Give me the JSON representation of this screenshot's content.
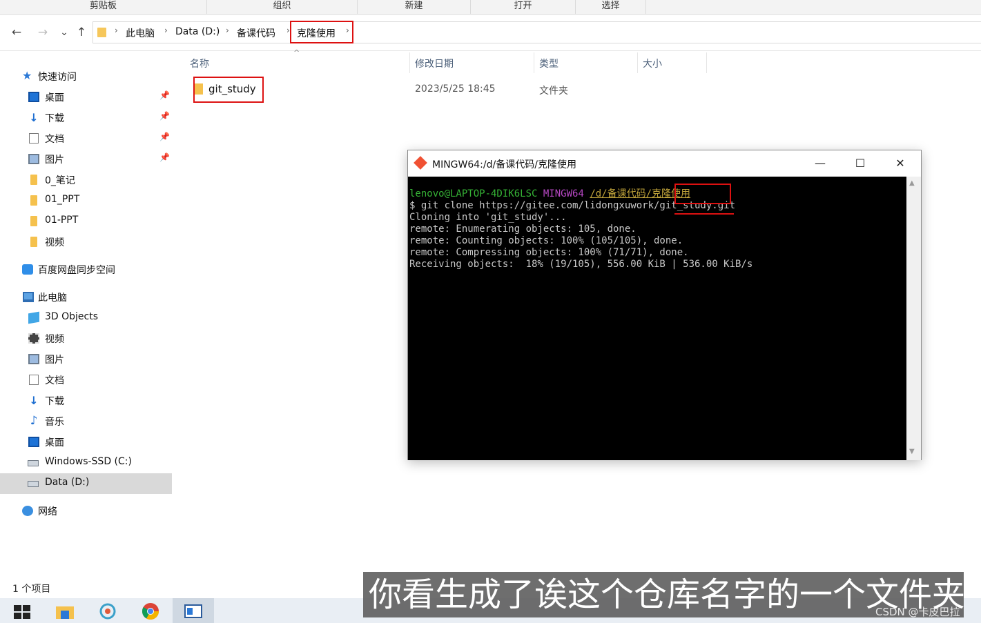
{
  "ribbon": {
    "groups": [
      "剪贴板",
      "组织",
      "新建",
      "打开",
      "选择"
    ]
  },
  "nav": {
    "back_icon": "←",
    "forward_icon": "→",
    "recent_icon": "⌄",
    "up_icon": "↑"
  },
  "address": {
    "crumbs": [
      "此电脑",
      "Data (D:)",
      "备课代码",
      "克隆使用"
    ],
    "separator": "›"
  },
  "sidebar": {
    "quick_access": "快速访问",
    "items_quick": [
      "桌面",
      "下载",
      "文档",
      "图片",
      "0_笔记",
      "01_PPT",
      "01-PPT",
      "视频"
    ],
    "baidu": "百度网盘同步空间",
    "this_pc": "此电脑",
    "items_pc": [
      "3D Objects",
      "视频",
      "图片",
      "文档",
      "下载",
      "音乐",
      "桌面",
      "Windows-SSD (C:)",
      "Data (D:)"
    ],
    "network": "网络"
  },
  "filelist": {
    "headers": [
      "名称",
      "修改日期",
      "类型",
      "大小"
    ],
    "rows": [
      {
        "name": "git_study",
        "date": "2023/5/25 18:45",
        "type": "文件夹",
        "size": ""
      }
    ]
  },
  "status": {
    "count": "1 个项目"
  },
  "terminal": {
    "title": "MINGW64:/d/备课代码/克隆使用",
    "prompt_user": "lenovo@LAPTOP-4DIK6LSC",
    "prompt_env": "MINGW64",
    "prompt_path_a": "/d/备课代码",
    "prompt_path_b": "/克隆使用",
    "lines": [
      "$ git clone https://gitee.com/lidongxuwork/git_study.git",
      "Cloning into 'git_study'...",
      "remote: Enumerating objects: 105, done.",
      "remote: Counting objects: 100% (105/105), done.",
      "remote: Compressing objects: 100% (71/71), done.",
      "Receiving objects:  18% (19/105), 556.00 KiB | 536.00 KiB/s"
    ],
    "minimize": "—",
    "maximize": "☐",
    "close": "✕"
  },
  "subtitle": "你看生成了诶这个仓库名字的一个文件夹",
  "watermark": "CSDN @卡皮巴拉",
  "colors": {
    "highlight": "#dd1111",
    "folder": "#f5c14d",
    "terminal_bg": "#000000"
  }
}
